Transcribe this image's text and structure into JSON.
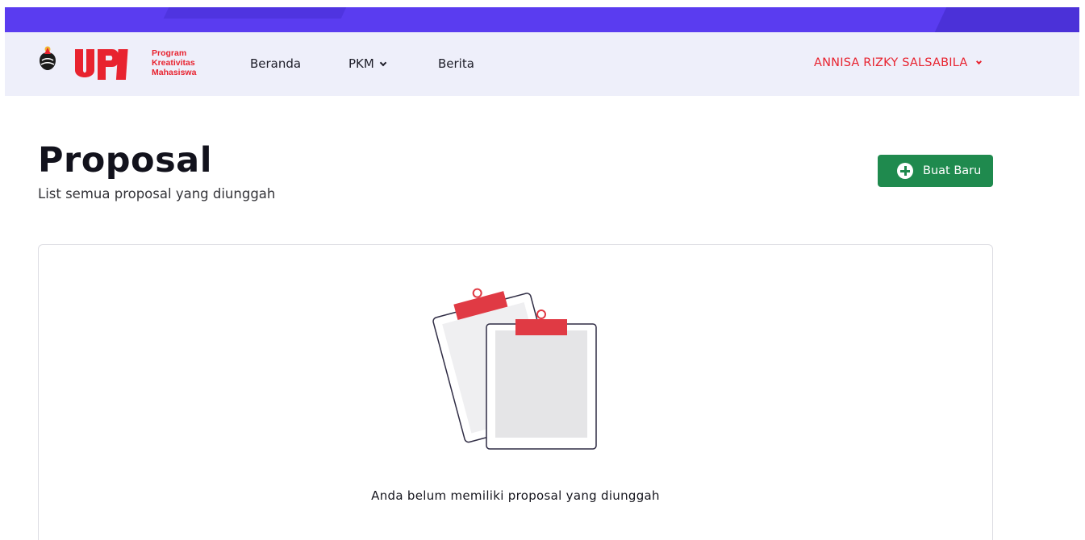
{
  "brand": {
    "logo_name": "UPI",
    "logo_text_lines": [
      "Program",
      "Kreativitas",
      "Mahasiswa"
    ]
  },
  "nav": {
    "items": [
      {
        "label": "Beranda"
      },
      {
        "label": "PKM",
        "has_dropdown": true
      },
      {
        "label": "Berita"
      }
    ],
    "user": {
      "name": "ANNISA RIZKY SALSABILA",
      "has_dropdown": true
    }
  },
  "header": {
    "title": "Proposal",
    "subtitle": "List semua proposal yang diunggah",
    "create_button": {
      "label": "Buat Baru",
      "icon": "plus-circle-icon"
    }
  },
  "empty_state": {
    "icon": "clipboards-icon",
    "message": "Anda belum memiliki proposal yang diunggah"
  },
  "colors": {
    "top_strip": "#5a3cf0",
    "navbar_bg": "#eeeffa",
    "brand_red": "#e8232f",
    "button_green": "#1f8a4e",
    "clip_red": "#e03a44"
  }
}
